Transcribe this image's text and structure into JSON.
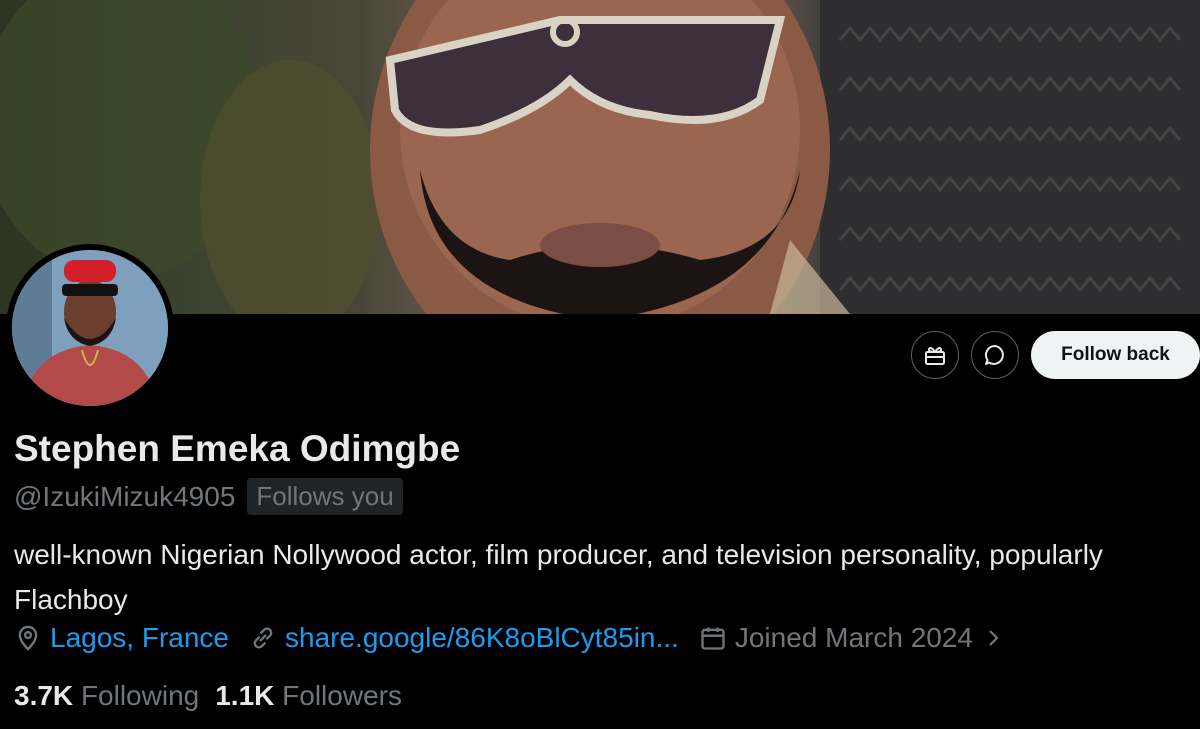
{
  "profile": {
    "display_name": "Stephen Emeka Odimgbe",
    "handle": "@IzukiMizuk4905",
    "follows_you_badge": "Follows you",
    "bio": "well-known Nigerian Nollywood actor, film producer, and television personality, popularly Flachboy",
    "location": "Lagos, France",
    "website": "share.google/86K8oBlCyt85in...",
    "joined": "Joined March 2024",
    "following_count": "3.7K",
    "following_label": "Following",
    "followers_count": "1.1K",
    "followers_label": "Followers"
  },
  "actions": {
    "follow_back_label": "Follow back"
  },
  "icons": {
    "gift": "gift-icon",
    "message": "message-icon",
    "location": "location-pin-icon",
    "link": "link-icon",
    "calendar": "calendar-icon",
    "chevron": "chevron-right-icon"
  },
  "colors": {
    "background": "#000000",
    "text_primary": "#e7e9ea",
    "text_secondary": "#71767b",
    "link": "#1d9bf0",
    "button_bg": "#eff3f4"
  }
}
